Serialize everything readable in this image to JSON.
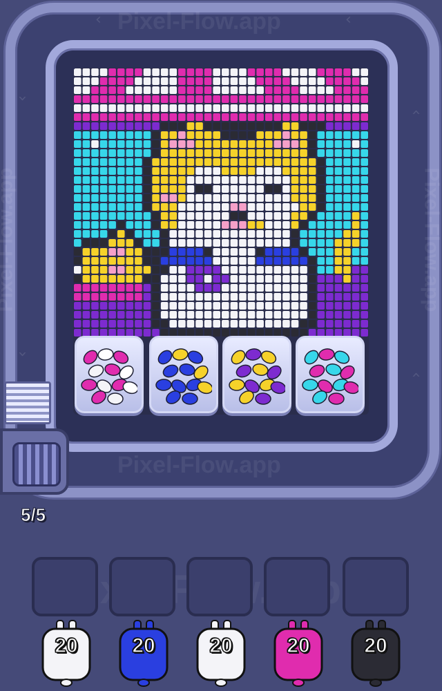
{
  "watermark": "Pixel-Flow.app",
  "conveyor": {
    "capacity_label": "5/5"
  },
  "palette": {
    "W": "#f4f4f8",
    "M": "#e02cae",
    "P": "#7d2bd0",
    "C": "#37d7ea",
    "Y": "#f6d22a",
    "B": "#2a3fe0",
    "K": "#2b2b34",
    "S": "#f5a0c8"
  },
  "pixel_art": {
    "cols": 34,
    "rows": 30,
    "grid": [
      "WWWWMMMMWWWWMMMMWWWWMMMMWWWWMMMMWW",
      "WWWMMMMWWWWWMMMMWWWWWMMMMWWWWMMMMW",
      "WWMMMMWWWWWWMMMMWWWWWWMMMMWWWWMMMM",
      "MMMMMMMMMMMMMMMMMMMMMMMMMMMMMMMMMM",
      "WWWWWWWWWWWWWWWWWWWWWWWWWWWWWWWWWW",
      "MMMMMMMMMMMMMMMMMMMMMMMMMMMMMMMMMM",
      "PPPPPPPPPPKKKYYKKKKKKKKKYYKKKPPPPP",
      "CCCCCCCCCKYYSYYYYKKKKYYYSYYKCCCCCC",
      "CCWCCCCCCKYSSSYYYYYYYYYSSSYKCCCCWC",
      "CCCCCCCCCKYYYYYYYYYYYYYYYYYKCCCCCC",
      "CCCCCCCCKYYYYYYYYYYYYYYYYYYYKCCCCC",
      "CCCCCCCCKYYYYYWWWYYYYWWWYYYYKCCCCC",
      "CCCCCCCCKYYYYWWWWWWWWWWWWYYYKCCCCC",
      "CCCCCCCCKYYYYWKKWWWWWWKKWYYYKCCCCC",
      "CCCCCCCCKYSSYWWWWWWWWWWWWYYYKCCCCC",
      "CCCCCCCCKYYYWWWWWWSSWWWWWWYYKCCCCC",
      "CCCCCCCCCKYYWWWWWWKKWWWWWYYKCCCCYC",
      "CCCCCKCCCKYYWWWWWSSSYYWWWYKCCCCCYC",
      "CCCCKYKCCCKWWWWWWWWWWWWWWKCCCCCYYC",
      "CKKKYYYKCCKWWWWWWWWWWWWWWKCCCCYYYC",
      "KYYYSSYYKKKBBBBKWWWWWKBBBBKCCCYYCC",
      "KYYYYYYYKKBBBBBBWWWWWBBBBBBKCCYYCC",
      "WYYYSSYYYKKWWPPPPWWWWWWWWWWKCCYYPP",
      "KYYYYYYYKKWWWPPWPPWWWWWWWWWKPPPYPP",
      "MMMMMMMMPKWWWWPPPWWWWWWWWWWKPPPPPP",
      "MMMMMMMMPKWWWWWWWWWWWWWWWWWKPPPPPP",
      "PPPPPPPPPKWWWWWWWWWWWWWWWWWKPPPPPP",
      "PPPPPPPPPKWWWWWWWWWWWWWWWWWKPPPPPP",
      "PPPPPPPPPKKWWWWWWWWWWWWWWWKKPPPPPP",
      "PPPPPPPPPPKKKKKKKKKKKKKKKKKPPPPPPP"
    ]
  },
  "trays": [
    {
      "name": "tray-1",
      "colors": [
        "#e02cae",
        "#ffffff",
        "#e02cae",
        "#f4f4f8"
      ]
    },
    {
      "name": "tray-2",
      "colors": [
        "#2a3fe0",
        "#f6d22a",
        "#2a3fe0",
        "#2a3fe0"
      ]
    },
    {
      "name": "tray-3",
      "colors": [
        "#f6d22a",
        "#7d2bd0",
        "#f6d22a",
        "#7d2bd0"
      ]
    },
    {
      "name": "tray-4",
      "colors": [
        "#37d7ea",
        "#e02cae",
        "#37d7ea",
        "#e02cae"
      ]
    }
  ],
  "slots": [
    {
      "name": "slot-1"
    },
    {
      "name": "slot-2"
    },
    {
      "name": "slot-3"
    },
    {
      "name": "slot-4"
    },
    {
      "name": "slot-5"
    }
  ],
  "shooters": [
    {
      "name": "shooter-white-1",
      "color": "#f4f4f8",
      "count": "20"
    },
    {
      "name": "shooter-blue",
      "color": "#2a3fe0",
      "count": "20"
    },
    {
      "name": "shooter-white-2",
      "color": "#f4f4f8",
      "count": "20"
    },
    {
      "name": "shooter-pink",
      "color": "#e02cae",
      "count": "20"
    },
    {
      "name": "shooter-black",
      "color": "#2b2b34",
      "count": "20"
    }
  ]
}
